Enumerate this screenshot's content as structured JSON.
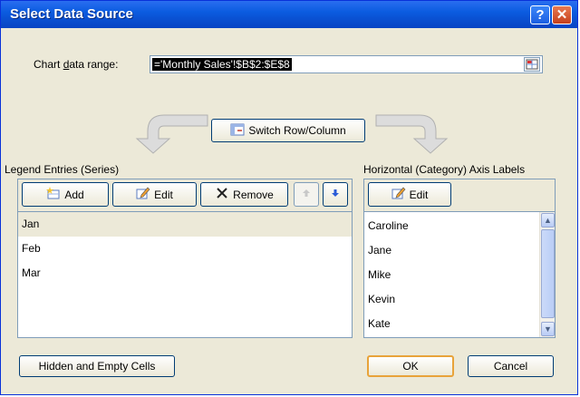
{
  "window": {
    "title": "Select Data Source",
    "help_glyph": "?",
    "close_glyph": "✕"
  },
  "range": {
    "label": "Chart data range:",
    "value": "='Monthly Sales'!$B$2:$E$8"
  },
  "switch_label": "Switch Row/Column",
  "legend": {
    "header": "Legend Entries (Series)",
    "add": "Add",
    "edit": "Edit",
    "remove": "Remove",
    "items": [
      "Jan",
      "Feb",
      "Mar"
    ]
  },
  "axis": {
    "header": "Horizontal (Category) Axis Labels",
    "edit": "Edit",
    "items": [
      "Caroline",
      "Jane",
      "Mike",
      "Kevin",
      "Kate"
    ]
  },
  "footer": {
    "hidden_cells": "Hidden and Empty Cells",
    "ok": "OK",
    "cancel": "Cancel"
  },
  "colors": {
    "title_bar": "#0a4fd0",
    "dialog_bg": "#ece9d8",
    "button_border": "#003c74"
  }
}
